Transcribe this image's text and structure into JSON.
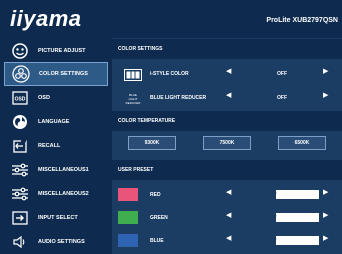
{
  "header": {
    "logo": "iiyama",
    "model": "ProLite XUB2797QSN"
  },
  "sidebar": {
    "items": [
      {
        "label": "PICTURE ADJUST",
        "icon": "smiley-icon"
      },
      {
        "label": "COLOR SETTINGS",
        "icon": "color-palette-icon",
        "selected": true
      },
      {
        "label": "OSD",
        "icon": "osd-icon"
      },
      {
        "label": "LANGUAGE",
        "icon": "globe-icon"
      },
      {
        "label": "RECALL",
        "icon": "recall-icon"
      },
      {
        "label": "MISCELLANEOUS1",
        "icon": "sliders-icon"
      },
      {
        "label": "MISCELLANEOUS2",
        "icon": "sliders-icon"
      },
      {
        "label": "INPUT SELECT",
        "icon": "input-select-icon"
      },
      {
        "label": "AUDIO SETTINGS",
        "icon": "speaker-icon"
      }
    ]
  },
  "main": {
    "color_settings_title": "COLOR SETTINGS",
    "istyle": {
      "label": "i-STYLE COLOR",
      "value": "OFF",
      "icon_text": "i-S"
    },
    "blue_light": {
      "label": "BLUE LIGHT REDUCER",
      "value": "OFF",
      "icon_text": "BLUE LIGHT REDUCER"
    },
    "temp_title": "COLOR TEMPERATURE",
    "temps": [
      "9300K",
      "7500K",
      "6500K"
    ],
    "preset_title": "USER PRESET",
    "presets": [
      {
        "label": "RED",
        "value": 50,
        "color": "#e8547a"
      },
      {
        "label": "GREEN",
        "value": 50,
        "color": "#3fae4f"
      },
      {
        "label": "BLUE",
        "value": 50,
        "color": "#2e64b2"
      }
    ],
    "arrow_left": "◀",
    "arrow_right": "▶"
  },
  "colors": {
    "background": "#0e2b4f",
    "panel": "#1b3c63",
    "selected": "#2d5a87"
  }
}
